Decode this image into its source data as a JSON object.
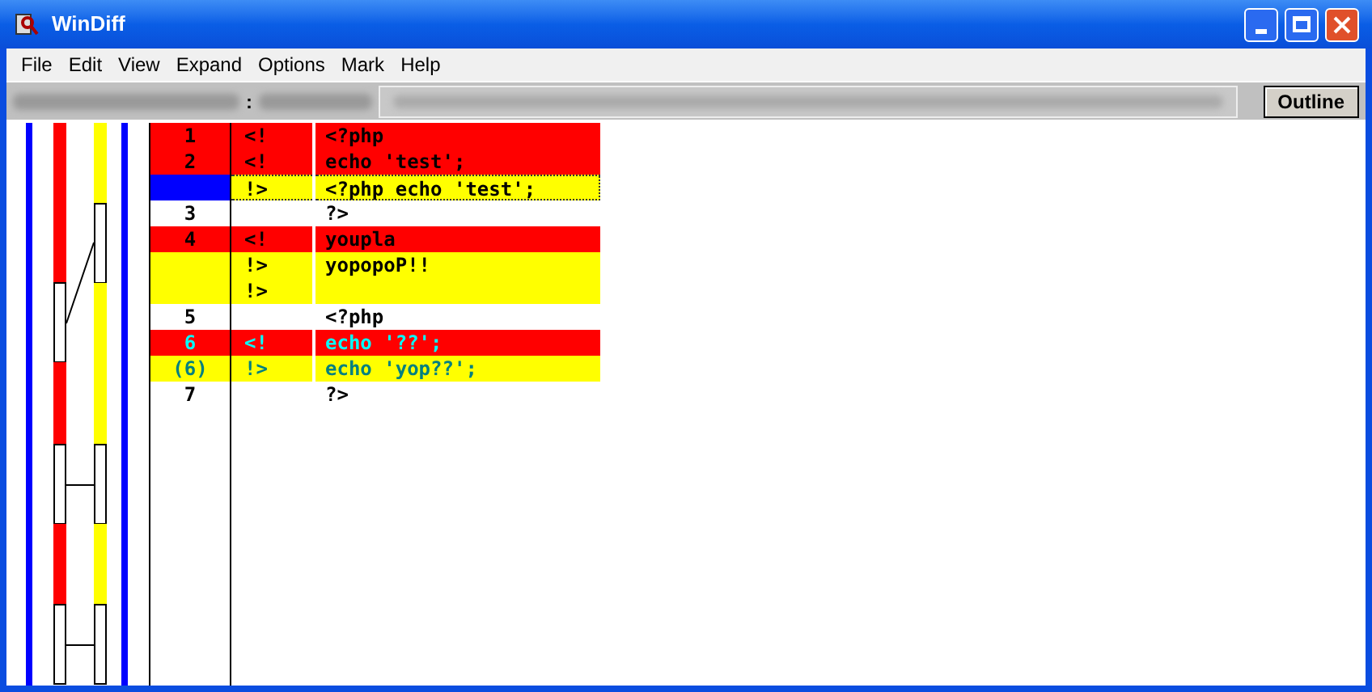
{
  "window": {
    "title": "WinDiff"
  },
  "menu": [
    {
      "label": "File"
    },
    {
      "label": "Edit"
    },
    {
      "label": "View"
    },
    {
      "label": "Expand"
    },
    {
      "label": "Options"
    },
    {
      "label": "Mark"
    },
    {
      "label": "Help"
    }
  ],
  "path_bar": {
    "separator": ":",
    "button": "Outline"
  },
  "rows": [
    {
      "number": "1",
      "marker": "<!",
      "text": "<?php",
      "kind": "left",
      "moved": false,
      "selected": false
    },
    {
      "number": "2",
      "marker": "<!",
      "text": "echo 'test';",
      "kind": "left",
      "moved": false,
      "selected": false
    },
    {
      "number": "",
      "marker": "!>",
      "text": "<?php echo 'test';",
      "kind": "right",
      "moved": false,
      "selected": true
    },
    {
      "number": "3",
      "marker": "",
      "text": "?>",
      "kind": "same",
      "moved": false,
      "selected": false
    },
    {
      "number": "4",
      "marker": "<!",
      "text": "youpla",
      "kind": "left",
      "moved": false,
      "selected": false
    },
    {
      "number": "",
      "marker": "!>",
      "text": "yopopoP!!",
      "kind": "right",
      "moved": false,
      "selected": false
    },
    {
      "number": "",
      "marker": "!>",
      "text": "",
      "kind": "right",
      "moved": false,
      "selected": false
    },
    {
      "number": "5",
      "marker": "",
      "text": "<?php",
      "kind": "same",
      "moved": false,
      "selected": false
    },
    {
      "number": "6",
      "marker": "<!",
      "text": "echo '??';",
      "kind": "left",
      "moved": true,
      "selected": false
    },
    {
      "number": "(6)",
      "marker": "!>",
      "text": "echo 'yop??';",
      "kind": "right",
      "moved": true,
      "selected": false
    },
    {
      "number": "7",
      "marker": "",
      "text": "?>",
      "kind": "same",
      "moved": false,
      "selected": false
    }
  ]
}
